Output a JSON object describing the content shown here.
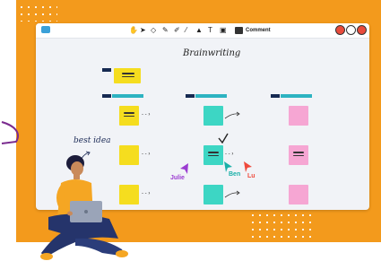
{
  "toolbar": {
    "tools": [
      "hand-icon",
      "pointer-icon",
      "eraser-icon",
      "pen-icon",
      "highlighter-icon",
      "line-icon",
      "shape-icon",
      "text-icon",
      "sticky-note-icon"
    ],
    "text_tool": "T",
    "comment_label": "Comment",
    "avatars": [
      {
        "color": "#e94b3c"
      },
      {
        "color": "#ffffff"
      },
      {
        "color": "#e94b3c"
      }
    ]
  },
  "board": {
    "title": "Brainwriting"
  },
  "annotation": {
    "best_idea": "best idea"
  },
  "cursors": [
    {
      "name": "Julie",
      "color": "#9b3bd1"
    },
    {
      "name": "Ben",
      "color": "#1ab0a8"
    },
    {
      "name": "Lu",
      "color": "#ef4a3c"
    }
  ],
  "colors": {
    "background": "#f39a1c",
    "yellow_note": "#f5dd1f",
    "teal_note": "#3dd6c4",
    "pink_note": "#f6a6d3",
    "header_navy": "#162a52",
    "header_teal": "#2db3c1"
  }
}
